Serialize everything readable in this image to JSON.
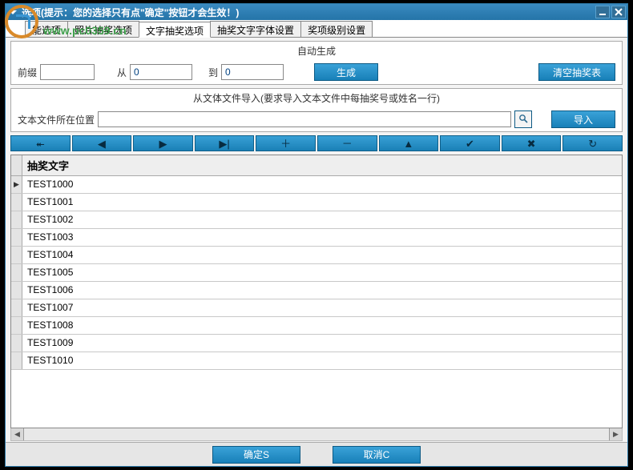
{
  "window": {
    "title": "选项(提示：您的选择只有点\"确定\"按钮才会生效！)"
  },
  "watermark": {
    "url": "www.pc0359.cn"
  },
  "tabs": {
    "items": [
      {
        "label": "能选项"
      },
      {
        "label": "照片抽奖选项"
      },
      {
        "label": "文字抽奖选项"
      },
      {
        "label": "抽奖文字字体设置"
      },
      {
        "label": "奖项级别设置"
      }
    ],
    "active_index": 2
  },
  "auto_gen": {
    "title": "自动生成",
    "prefix_label": "前缀",
    "prefix_value": "",
    "from_label": "从",
    "from_value": "0",
    "to_label": "到",
    "to_value": "0",
    "generate_btn": "生成",
    "clear_btn": "清空抽奖表"
  },
  "import": {
    "title": "从文体文件导入(要求导入文本文件中每抽奖号或姓名一行)",
    "path_label": "文本文件所在位置",
    "path_value": "",
    "import_btn": "导入"
  },
  "nav_icons": {
    "first": "⯬",
    "prev": "◀",
    "next": "▶",
    "last": "▶|",
    "add": "＋",
    "delete": "－",
    "up": "▲",
    "check": "✔",
    "cancel": "✖",
    "refresh": "↻"
  },
  "grid": {
    "column_header": "抽奖文字",
    "rows": [
      "TEST1000",
      "TEST1001",
      "TEST1002",
      "TEST1003",
      "TEST1004",
      "TEST1005",
      "TEST1006",
      "TEST1007",
      "TEST1008",
      "TEST1009",
      "TEST1010"
    ],
    "current_row": 0
  },
  "footer": {
    "ok": "确定S",
    "cancel": "取消C"
  }
}
